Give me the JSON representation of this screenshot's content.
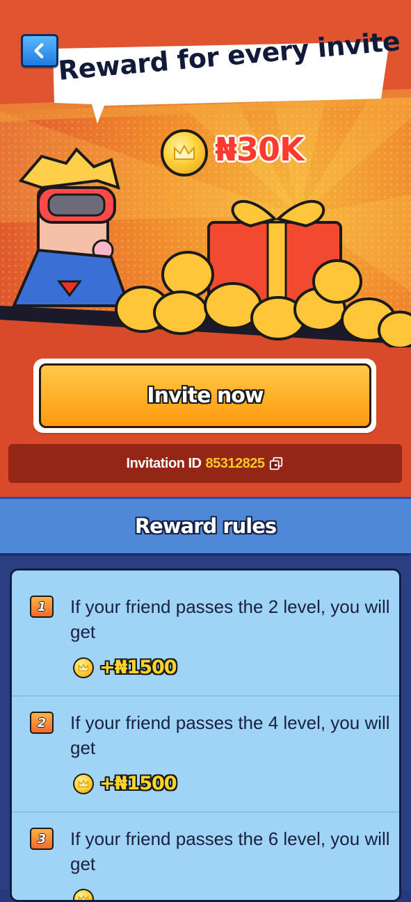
{
  "hero": {
    "headline": "Reward for every invite",
    "total_reward": "₦30K",
    "invite_button_label": "Invite now",
    "invitation_id_label": "Invitation ID",
    "invitation_id_value": "85312825"
  },
  "rules": {
    "title": "Reward rules",
    "items": [
      {
        "number": "1",
        "text": "If your friend passes the 2 level, you will get",
        "reward": "+₦1500"
      },
      {
        "number": "2",
        "text": "If your friend passes the 4 level, you will get",
        "reward": "+₦1500"
      },
      {
        "number": "3",
        "text": "If your friend passes the 6 level, you will get",
        "reward": ""
      }
    ]
  },
  "colors": {
    "hero_orange": "#f08a2c",
    "button_orange": "#ffb12a",
    "rules_header_blue": "#5088d8",
    "rules_card_blue": "#9fd4f6",
    "accent_yellow": "#ffc629",
    "reward_red": "#ff3b2f"
  },
  "icons": {
    "back": "chevron-left-icon",
    "copy": "copy-icon",
    "coin": "coin-icon"
  }
}
